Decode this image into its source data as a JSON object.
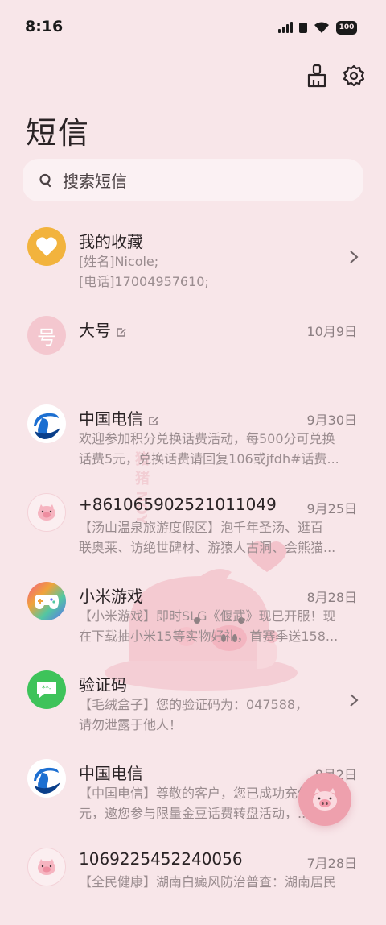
{
  "status_bar": {
    "time": "8:16",
    "battery": "100"
  },
  "header": {
    "title": "短信",
    "actions": [
      {
        "icon": "brush-icon"
      },
      {
        "icon": "gear-icon"
      }
    ]
  },
  "search": {
    "placeholder": "搜索短信"
  },
  "conversations": [
    {
      "name": "我的收藏",
      "date": "",
      "avatar": "heart-icon",
      "avatar_color": "#f2b33d",
      "lines": [
        "[姓名]Nicole;",
        "[电话]17004957610;"
      ],
      "has_chevron": true,
      "edited": false
    },
    {
      "name": "大号",
      "date": "10月9日",
      "avatar": "number-avatar",
      "avatar_text": "号",
      "avatar_color": "#f4c7cf",
      "lines": [],
      "has_chevron": false,
      "edited": true
    },
    {
      "name": "中国电信",
      "date": "9月30日",
      "avatar": "china-telecom-logo",
      "avatar_color": "#ffffff",
      "lines": [
        "欢迎参加积分兑换话费活动，每500分可兑换",
        "话费5元，兑换话费请回复106或jfdh#话费..."
      ],
      "has_chevron": false,
      "edited": true
    },
    {
      "name": "+8610659025210110​49",
      "date": "9月25日",
      "avatar": "pig-avatar",
      "avatar_color": "#fbeef0",
      "lines": [
        "【汤山温泉旅游度假区】泡千年圣汤、逛百",
        "联奥莱、访绝世碑材、游猿人古洞、会熊猫..."
      ],
      "has_chevron": false,
      "edited": false
    },
    {
      "name": "小米游戏",
      "date": "8月28日",
      "avatar": "gamepad-icon",
      "avatar_color": "#7a6cf2",
      "lines": [
        "【小米游戏】即时SLG《偃武》现已开服！现",
        "在下载抽小米15等实物好礼，首赛季送158..."
      ],
      "has_chevron": false,
      "edited": false
    },
    {
      "name": "验证码",
      "date": "",
      "avatar": "message-bubble-icon",
      "avatar_color": "#3ec35a",
      "lines": [
        "【毛绒盒子】您的验证码为：047588，",
        "请勿泄露于他人！"
      ],
      "has_chevron": true,
      "edited": false
    },
    {
      "name": "中国电信",
      "date": "8月2日",
      "avatar": "china-telecom-logo",
      "avatar_color": "#ffffff",
      "lines": [
        "【中国电信】尊敬的客户，您已成功充值50",
        "元，邀您参与限量金豆话费转盘活动，..."
      ],
      "has_chevron": false,
      "edited": false
    },
    {
      "name": "1069225452240056",
      "date": "7月28日",
      "avatar": "pig-avatar",
      "avatar_color": "#fbeef0",
      "lines": [
        "【全民健康】湖南白癜风防治普查：湖南居民",
        ""
      ],
      "has_chevron": false,
      "edited": false
    }
  ],
  "watermark": {
    "text": "猪 猪 NOY"
  },
  "fab": {
    "icon": "pig-compose-icon"
  }
}
